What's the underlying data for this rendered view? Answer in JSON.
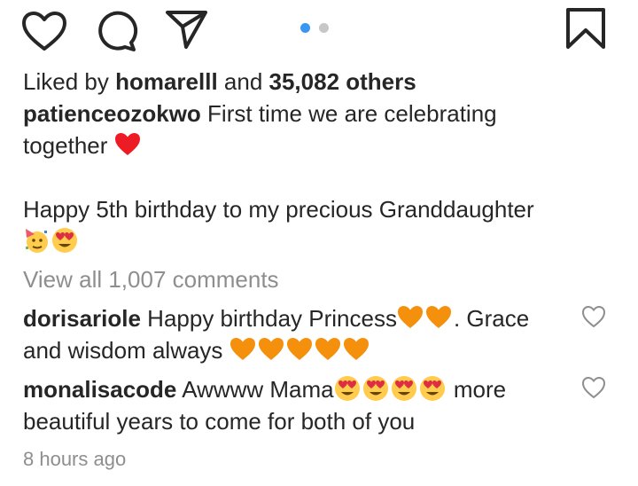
{
  "likes": {
    "prefix": "Liked by ",
    "user": "homarelll",
    "middle": " and ",
    "count": "35,082 others"
  },
  "caption": {
    "user": "patienceozokwo",
    "line1": " First time we are celebrating",
    "line2": "together",
    "line3": "Happy 5th birthday to my precious Granddaughter"
  },
  "view_all": "View all 1,007 comments",
  "comments": [
    {
      "user": "dorisariole",
      "text_a": " Happy birthday Princess",
      "text_b": ". Grace",
      "text_c": "and wisdom always"
    },
    {
      "user": "monalisacode",
      "text_a": " Awwww Mama",
      "text_b": " more",
      "text_c": "beautiful years to come for both of you"
    }
  ],
  "timestamp": "8 hours ago",
  "icons": {
    "like": "heart-outline-icon",
    "comment": "comment-bubble-icon",
    "share": "paper-plane-icon",
    "save": "bookmark-icon",
    "comment_like": "small-heart-outline-icon"
  },
  "colors": {
    "accent": "#3897f0",
    "muted": "#8e8e8e",
    "text": "#262626",
    "heart": "#ed1c24",
    "orange_heart": "#f4900c"
  }
}
